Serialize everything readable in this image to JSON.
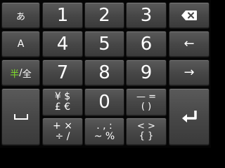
{
  "keyboard": {
    "row1": {
      "mode_kana": "あ",
      "k1": "1",
      "k2": "2",
      "k3": "3"
    },
    "row2": {
      "mode_alpha": "A",
      "k4": "4",
      "k5": "5",
      "k6": "6"
    },
    "row3": {
      "half": "半",
      "slash": "/",
      "full": "全",
      "k7": "7",
      "k8": "8",
      "k9": "9"
    },
    "row4": {
      "currency_top": "¥ $",
      "currency_bottom": "£ €",
      "k0": "0",
      "dash_top": "— =",
      "dash_bottom": "( )"
    },
    "row5": {
      "math_top": "+ ×",
      "math_bottom": "÷ /",
      "punct_top": ". , :",
      "punct_bottom": "~ %",
      "bracket_top": "< >",
      "bracket_bottom": "{ }"
    },
    "side": {
      "left_arrow": "←",
      "right_arrow": "→"
    },
    "icons": {
      "backspace": "backspace-icon",
      "space": "space-icon",
      "enter": "enter-icon"
    },
    "colors": {
      "half_char": "#7fdc2a",
      "key_text": "#ffffff"
    }
  }
}
